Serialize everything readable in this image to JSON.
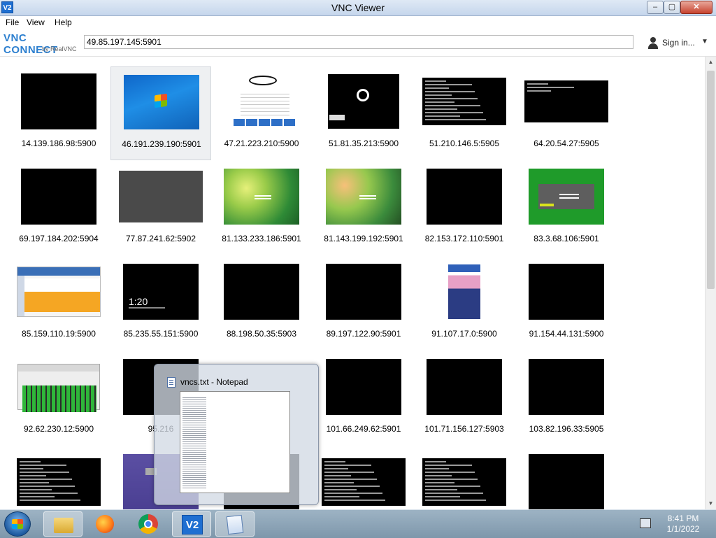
{
  "window": {
    "title": "VNC Viewer",
    "app_icon": "V2",
    "minimize_label": "–",
    "maximize_label": "▢",
    "close_label": "✕"
  },
  "menu": {
    "items": [
      "File",
      "View",
      "Help"
    ]
  },
  "toolbar": {
    "logo_main": "VNC CONNECT",
    "logo_sub": "by RealVNC",
    "address_value": "49.85.197.145:5901",
    "signin_label": "Sign in...",
    "signin_caret": "▼",
    "user_icon": "user-icon"
  },
  "connections": [
    {
      "label": "14.139.186.98:5900",
      "thumb": "black"
    },
    {
      "label": "46.191.239.190:5901",
      "thumb": "windows7-desktop",
      "selected": true
    },
    {
      "label": "47.21.223.210:5900",
      "thumb": "action-target-panel"
    },
    {
      "label": "51.81.35.213:5900",
      "thumb": "ubuntu-boot"
    },
    {
      "label": "51.210.146.5:5905",
      "thumb": "terminal"
    },
    {
      "label": "64.20.54.27:5905",
      "thumb": "terminal-sparse"
    },
    {
      "label": "69.197.184.202:5904",
      "thumb": "black"
    },
    {
      "label": "77.87.241.62:5902",
      "thumb": "grey"
    },
    {
      "label": "81.133.233.186:5901",
      "thumb": "green-wallpaper"
    },
    {
      "label": "81.143.199.192:5901",
      "thumb": "green-wallpaper-2"
    },
    {
      "label": "82.153.172.110:5901",
      "thumb": "black"
    },
    {
      "label": "83.3.68.106:5901",
      "thumb": "green-login"
    },
    {
      "label": "85.159.110.19:5900",
      "thumb": "dashboard"
    },
    {
      "label": "85.235.55.151:5900",
      "thumb": "lock-screen",
      "time": "1:20"
    },
    {
      "label": "88.198.50.35:5903",
      "thumb": "black"
    },
    {
      "label": "89.197.122.90:5901",
      "thumb": "black"
    },
    {
      "label": "91.107.17.0:5900",
      "thumb": "phone-app"
    },
    {
      "label": "91.154.44.131:5900",
      "thumb": "black"
    },
    {
      "label": "92.62.230.12:5900",
      "thumb": "assistic-mixer"
    },
    {
      "label": "95.216",
      "thumb": "black"
    },
    {
      "label": "",
      "thumb": "hidden"
    },
    {
      "label": "101.66.249.62:5901",
      "thumb": "black"
    },
    {
      "label": "101.71.156.127:5903",
      "thumb": "black"
    },
    {
      "label": "103.82.196.33:5905",
      "thumb": "black"
    },
    {
      "label": "",
      "thumb": "terminal"
    },
    {
      "label": "",
      "thumb": "purple"
    },
    {
      "label": "",
      "thumb": "black"
    },
    {
      "label": "",
      "thumb": "terminal"
    },
    {
      "label": "",
      "thumb": "terminal"
    },
    {
      "label": "",
      "thumb": "black"
    }
  ],
  "notepad_preview": {
    "title": "vncs.txt - Notepad"
  },
  "taskbar": {
    "apps": [
      "windows-explorer-icon",
      "firefox-icon",
      "chrome-icon",
      "vnc-viewer-icon",
      "notepad-icon"
    ],
    "vnc_label": "V2",
    "time": "8:41 PM",
    "date": "1/1/2022"
  }
}
